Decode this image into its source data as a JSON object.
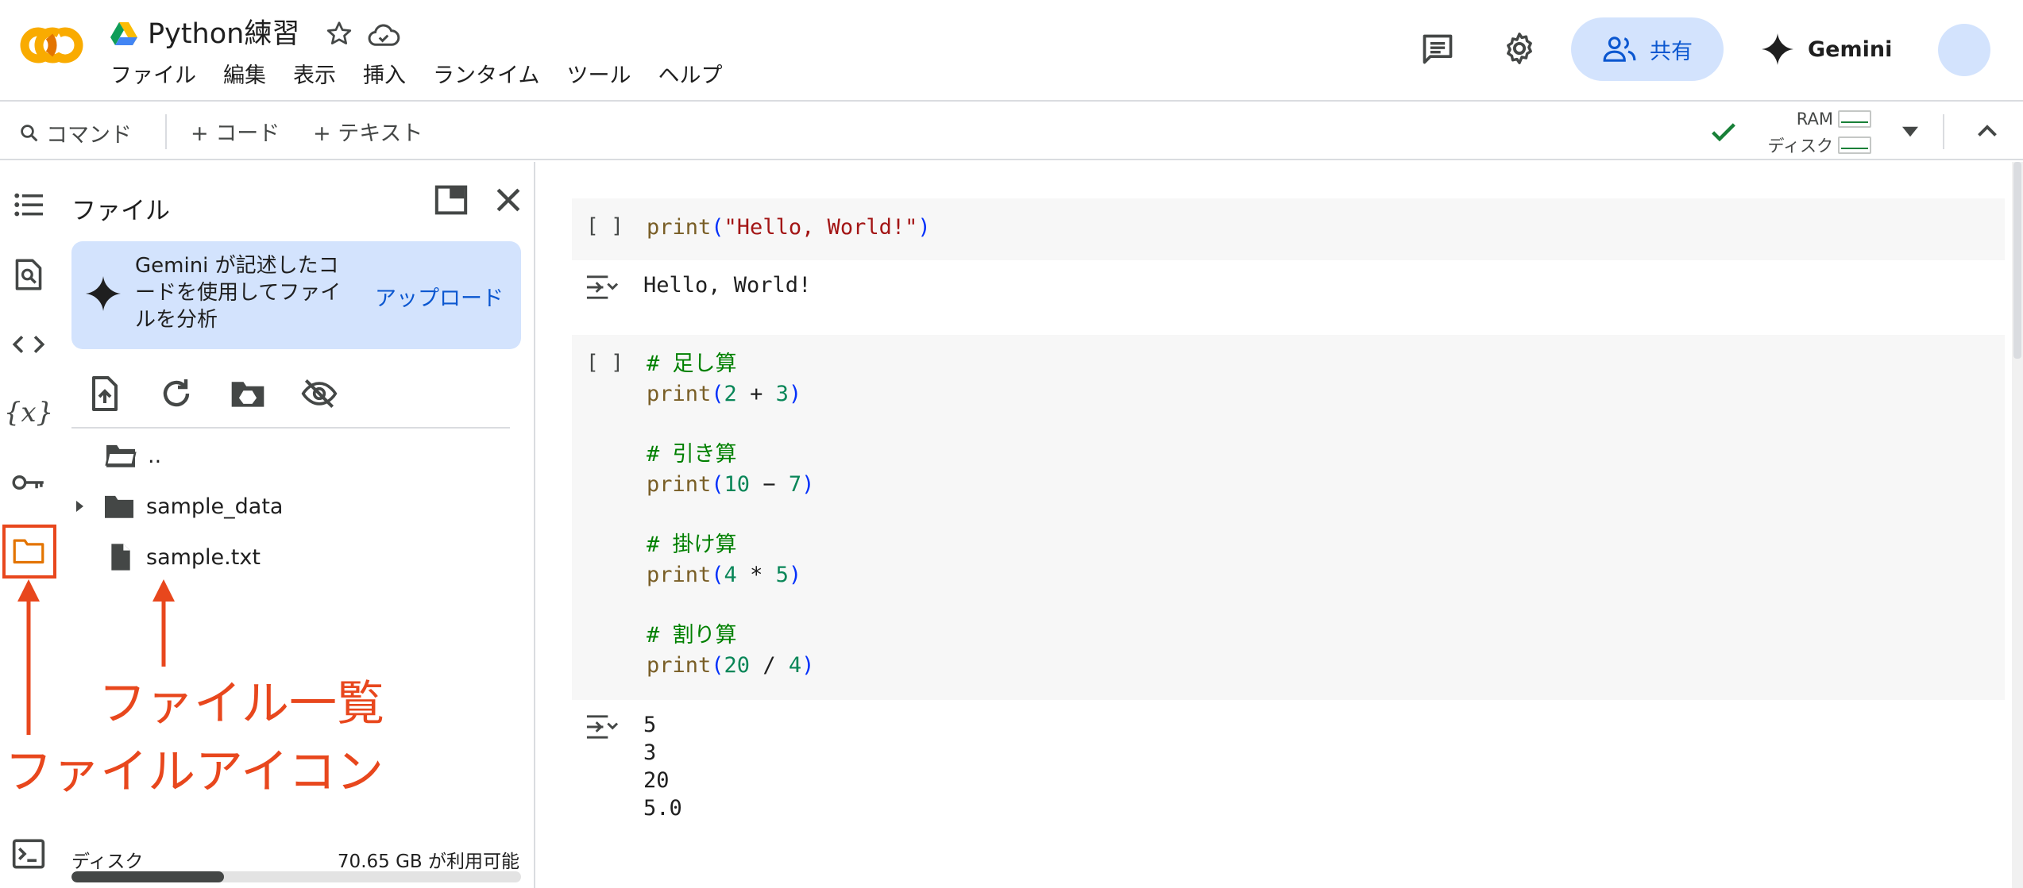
{
  "header": {
    "doc_title": "Python練習",
    "menu": [
      "ファイル",
      "編集",
      "表示",
      "挿入",
      "ランタイム",
      "ツール",
      "ヘルプ"
    ],
    "share_label": "共有",
    "gemini_label": "Gemini"
  },
  "toolbar": {
    "command_label": "コマンド",
    "add_code_label": "+ コード",
    "add_text_label": "+ テキスト",
    "ram_label": "RAM",
    "disk_label": "ディスク"
  },
  "rail": {
    "icons": [
      "toc-icon",
      "find-icon",
      "code-snippets-icon",
      "variables-icon",
      "secrets-key-icon",
      "files-folder-icon",
      "terminal-icon"
    ],
    "variables_glyph": "{x}"
  },
  "panel": {
    "title": "ファイル",
    "gemini_card_text": "Gemini が記述したコードを使用してファイルを分析",
    "upload_label": "アップロード",
    "tree": [
      {
        "name": "..",
        "type": "parent-folder"
      },
      {
        "name": "sample_data",
        "type": "folder"
      },
      {
        "name": "sample.txt",
        "type": "file"
      }
    ],
    "disk_label": "ディスク",
    "disk_free": "70.65 GB が利用可能",
    "disk_used_fraction": 0.34
  },
  "annotations": {
    "file_list": "ファイル一覧",
    "file_icon": "ファイルアイコン",
    "color": "#e8471d"
  },
  "cells": [
    {
      "run_label": "[ ]",
      "code_lines": [
        "print(\"Hello, World!\")"
      ],
      "output_lines": [
        "Hello, World!"
      ]
    },
    {
      "run_label": "[ ]",
      "code_lines": [
        "# 足し算",
        "print(2 + 3)",
        "",
        "# 引き算",
        "print(10 - 7)",
        "",
        "# 掛け算",
        "print(4 * 5)",
        "",
        "# 割り算",
        "print(20 / 4)"
      ],
      "output_lines": [
        "5",
        "3",
        "20",
        "5.0"
      ]
    }
  ],
  "colors": {
    "accent_blue": "#0b57d0",
    "share_bg": "#d3e3fd",
    "annotation": "#e8471d",
    "code_fn": "#795e26",
    "code_string": "#a31515",
    "code_number": "#098658",
    "code_comment": "#008000"
  }
}
